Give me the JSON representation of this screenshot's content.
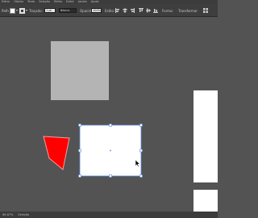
{
  "menu": {
    "items": [
      "Editar",
      "Objeto",
      "Texto",
      "Seleção",
      "Efeito",
      "Exibir",
      "Janela",
      "Ajuda"
    ]
  },
  "control_bar": {
    "selection_label": "Path",
    "stroke_label": "Traçado:",
    "stroke_value": "1 pt",
    "brush_value": "Básico",
    "opacity_label": "Opacid.",
    "opacity_value": "100%",
    "style_label": "Estilo:",
    "shape_label": "Forma:",
    "transform_label": "Transformar"
  },
  "canvas": {
    "background": "#535353",
    "gray_square_color": "#b4b4b4",
    "white_rect_color": "#ffffff",
    "red_shape_color": "#ff0000",
    "selection_color": "#5b8bd6"
  },
  "status": {
    "zoom": "66,67%",
    "tool": "Seleção"
  }
}
